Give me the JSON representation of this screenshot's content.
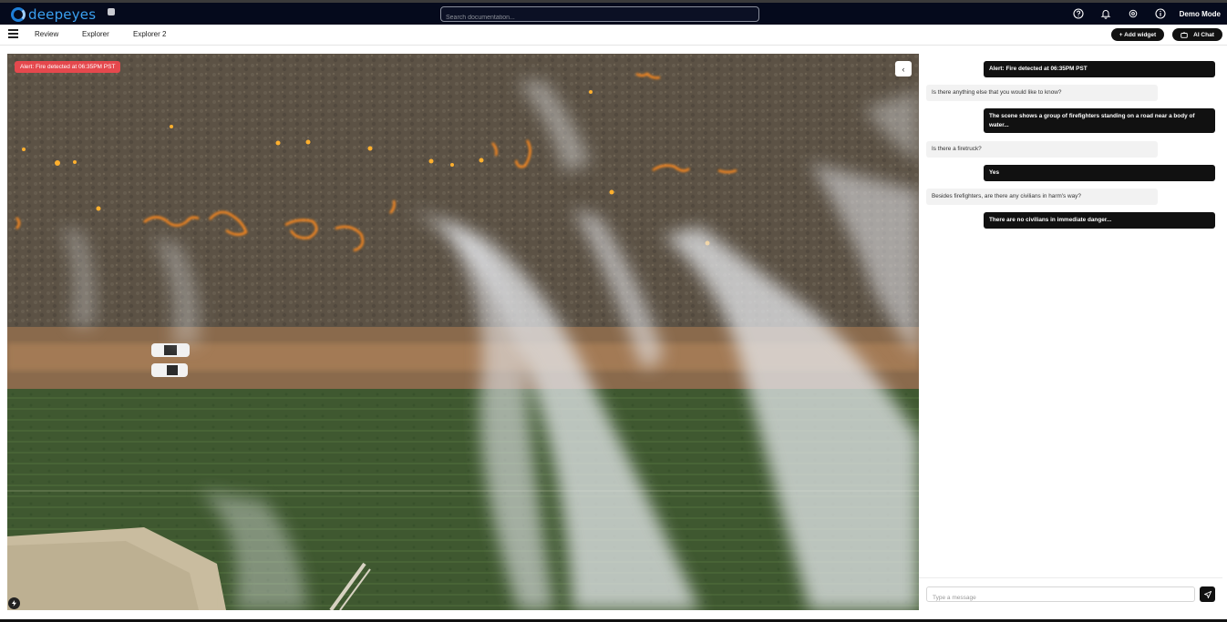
{
  "app": {
    "name": "deepeyes",
    "search_placeholder": "Search documentation...",
    "mode_label": "Demo Mode",
    "icons": [
      "help-icon",
      "bell-icon",
      "settings-icon",
      "info-icon"
    ]
  },
  "nav": {
    "tabs": [
      {
        "label": "Review"
      },
      {
        "label": "Explorer"
      },
      {
        "label": "Explorer 2"
      }
    ],
    "add_widget_label": "+ Add widget",
    "ai_chat_label": "AI Chat"
  },
  "video": {
    "alert_label": "Alert: Fire detected at 06:35PM PST",
    "colors": {
      "alert": "#e5484d"
    }
  },
  "chat": {
    "messages": [
      {
        "role": "user",
        "text": "Alert: Fire detected at 06:35PM PST"
      },
      {
        "role": "bot",
        "text": "Is there anything else that you would like to know?"
      },
      {
        "role": "user",
        "text": "The scene shows a group of firefighters standing on a road near a body of water..."
      },
      {
        "role": "bot",
        "text": "Is there a firetruck?"
      },
      {
        "role": "user",
        "text": "Yes"
      },
      {
        "role": "bot",
        "text": "Besides firefighters, are there any civilians in harm's way?"
      },
      {
        "role": "user",
        "text": "There are no civilians in immediate danger..."
      }
    ],
    "input_placeholder": "Type a message"
  }
}
